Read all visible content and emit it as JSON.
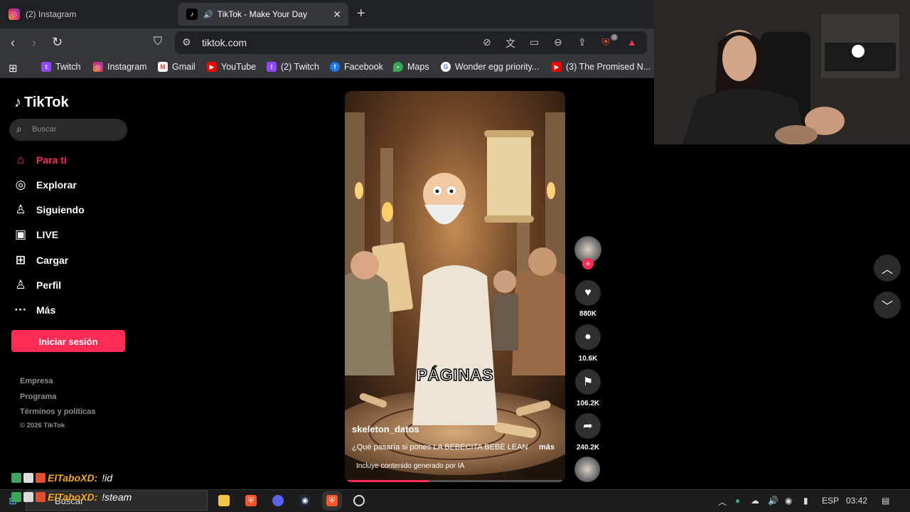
{
  "browser": {
    "tabs": [
      {
        "title": "(2) Instagram",
        "active": false
      },
      {
        "title": "TikTok - Make Your Day",
        "active": true
      }
    ],
    "url": "tiktok.com",
    "bookmarks": [
      {
        "label": "Twitch",
        "icon": "twitch-icon"
      },
      {
        "label": "Instagram",
        "icon": "instagram-icon"
      },
      {
        "label": "Gmail",
        "icon": "gmail-icon"
      },
      {
        "label": "YouTube",
        "icon": "youtube-icon"
      },
      {
        "label": "(2) Twitch",
        "icon": "twitch-icon"
      },
      {
        "label": "Facebook",
        "icon": "facebook-icon"
      },
      {
        "label": "Maps",
        "icon": "maps-icon"
      },
      {
        "label": "Wonder egg priority...",
        "icon": "google-icon"
      },
      {
        "label": "(3) The Promised N...",
        "icon": "youtube-icon"
      }
    ],
    "brave_badge": "6"
  },
  "tiktok": {
    "logo": "TikTok",
    "search_placeholder": "Buscar",
    "nav": [
      {
        "label": "Para ti",
        "icon": "home-icon",
        "active": true
      },
      {
        "label": "Explorar",
        "icon": "compass-icon",
        "active": false
      },
      {
        "label": "Siguiendo",
        "icon": "following-icon",
        "active": false
      },
      {
        "label": "LIVE",
        "icon": "live-icon",
        "active": false
      },
      {
        "label": "Cargar",
        "icon": "upload-icon",
        "active": false
      },
      {
        "label": "Perfil",
        "icon": "profile-icon",
        "active": false
      },
      {
        "label": "Más",
        "icon": "more-icon",
        "active": false
      }
    ],
    "login_button": "Iniciar sesión",
    "footer": [
      "Empresa",
      "Programa",
      "Términos y políticas"
    ],
    "copyright": "© 2026 TikTok",
    "video": {
      "overlay_text": "PÁGINAS",
      "username": "skeleton_datos",
      "description": "¿Qué pasaría si pones LA BEBECITA BEBÉ LEAN",
      "more": "más",
      "ai_label": "Incluye contenido generado por IA",
      "progress": 0.38
    },
    "actions": {
      "likes": "880K",
      "comments": "10.6K",
      "saves": "106.2K",
      "shares": "240.2K"
    }
  },
  "chat": [
    {
      "name": "ElTaboXD:",
      "message": "!id"
    },
    {
      "name": "ElTaboXD:",
      "message": "!steam"
    }
  ],
  "taskbar": {
    "search": "Buscar",
    "language": "ESP",
    "time": "03:42"
  },
  "colors": {
    "accent": "#fe2c55",
    "chat_name": "#f5a623"
  }
}
